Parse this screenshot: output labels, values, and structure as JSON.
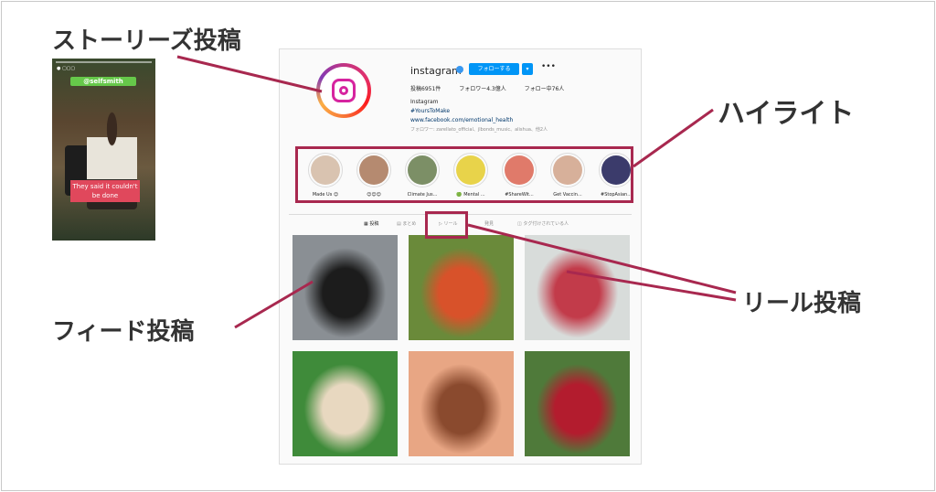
{
  "callouts": {
    "stories": "ストーリーズ投稿",
    "highlight": "ハイライト",
    "reels": "リール投稿",
    "feed": "フィード投稿"
  },
  "story": {
    "caption": "They said it couldn't be done",
    "tag": "@selfsmith"
  },
  "profile": {
    "username": "instagram",
    "follow_label": "フォローする",
    "more_icon": "•••",
    "stats": [
      "投稿6951件",
      "フォロワー4.3億人",
      "フォロー中76人"
    ],
    "bio_name": "Instagram",
    "bio_hashtag": "#YoursToMake",
    "bio_link": "www.facebook.com/emotional_health",
    "followed_by": "フォロワー: zarellato_official、jlbonds_music、alishua、他2人"
  },
  "highlights": [
    {
      "label": "Made Us 😊",
      "color": "#d9c3b0"
    },
    {
      "label": "😊😊😊",
      "color": "#b58a70"
    },
    {
      "label": "Climate Jus...",
      "color": "#7c8f66"
    },
    {
      "label": "🟢 Mental ...",
      "color": "#e8d34a"
    },
    {
      "label": "#ShareWit...",
      "color": "#e07a6a"
    },
    {
      "label": "Get Vaccin...",
      "color": "#d7b09a"
    },
    {
      "label": "#StopAsian...",
      "color": "#3b3b6b"
    }
  ],
  "tabs": [
    "投稿",
    "まとめ",
    "リール",
    "発見",
    "タグ付けされている人"
  ],
  "tiles": [
    {
      "name": "feed-post-1",
      "c1": "#8a8f94",
      "c2": "#1c1c1c"
    },
    {
      "name": "feed-post-2",
      "c1": "#6a8a3a",
      "c2": "#d8522a"
    },
    {
      "name": "reel-post-violin",
      "c1": "#d8dcda",
      "c2": "#c23b4a"
    },
    {
      "name": "feed-post-4",
      "c1": "#3f8b3a",
      "c2": "#e8d8c0"
    },
    {
      "name": "feed-post-5",
      "c1": "#e8a684",
      "c2": "#8a4a2e"
    },
    {
      "name": "feed-post-6",
      "c1": "#4f7a3a",
      "c2": "#b31c2e"
    }
  ],
  "accent": "#a8284f"
}
